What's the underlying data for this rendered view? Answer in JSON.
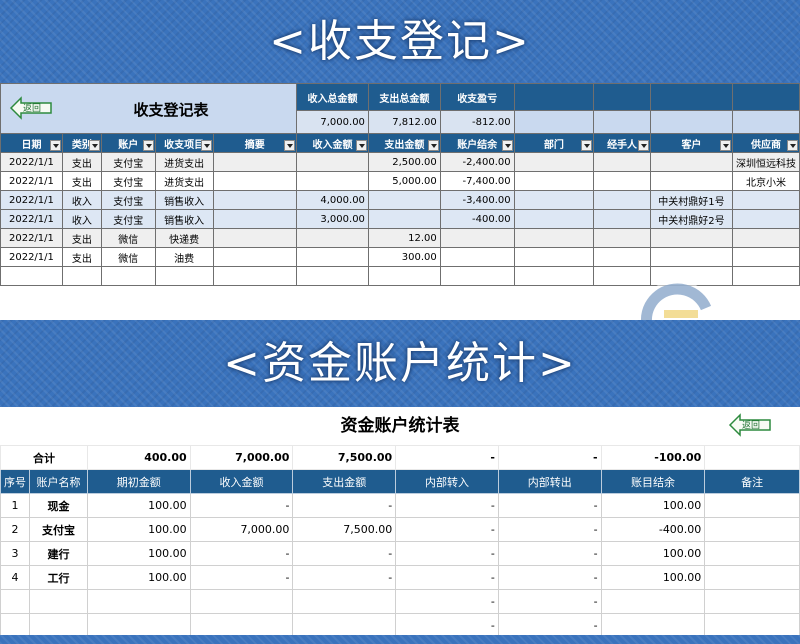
{
  "banner1": {
    "text": "<收支登记>"
  },
  "banner2": {
    "text": "<资金账户统计>"
  },
  "sheet1": {
    "back_label": "返回",
    "title": "收支登记表",
    "summary_labels": [
      "收入总金额",
      "支出总金额",
      "收支盈亏"
    ],
    "summary_values": [
      "7,000.00",
      "7,812.00",
      "-812.00"
    ],
    "headers": [
      "日期",
      "类别",
      "账户",
      "收支项目",
      "摘要",
      "收入金额",
      "支出金额",
      "账户结余",
      "部门",
      "经手人",
      "客户",
      "供应商"
    ],
    "rows": [
      [
        "2022/1/1",
        "支出",
        "支付宝",
        "进货支出",
        "",
        "",
        "2,500.00",
        "-2,400.00",
        "",
        "",
        "",
        "深圳恒远科技"
      ],
      [
        "2022/1/1",
        "支出",
        "支付宝",
        "进货支出",
        "",
        "",
        "5,000.00",
        "-7,400.00",
        "",
        "",
        "",
        "北京小米"
      ],
      [
        "2022/1/1",
        "收入",
        "支付宝",
        "销售收入",
        "",
        "4,000.00",
        "",
        "-3,400.00",
        "",
        "",
        "中关村鼎好1号",
        ""
      ],
      [
        "2022/1/1",
        "收入",
        "支付宝",
        "销售收入",
        "",
        "3,000.00",
        "",
        "-400.00",
        "",
        "",
        "中关村鼎好2号",
        ""
      ],
      [
        "2022/1/1",
        "支出",
        "微信",
        "快递费",
        "",
        "",
        "12.00",
        "",
        "",
        "",
        "",
        ""
      ],
      [
        "2022/1/1",
        "支出",
        "微信",
        "油费",
        "",
        "",
        "300.00",
        "",
        "",
        "",
        "",
        ""
      ],
      [
        "",
        "",
        "",
        "",
        "",
        "",
        "",
        "",
        "",
        "",
        "",
        ""
      ]
    ]
  },
  "sheet2": {
    "title": "资金账户统计表",
    "back_label": "返回",
    "total_label": "合计",
    "totals": [
      "400.00",
      "7,000.00",
      "7,500.00",
      "-",
      "-",
      "-100.00"
    ],
    "headers": [
      "序号",
      "账户名称",
      "期初金额",
      "收入金额",
      "支出金额",
      "内部转入",
      "内部转出",
      "账目结余",
      "备注"
    ],
    "rows": [
      [
        "1",
        "现金",
        "100.00",
        "-",
        "-",
        "-",
        "-",
        "100.00",
        ""
      ],
      [
        "2",
        "支付宝",
        "100.00",
        "7,000.00",
        "7,500.00",
        "-",
        "-",
        "-400.00",
        ""
      ],
      [
        "3",
        "建行",
        "100.00",
        "-",
        "-",
        "-",
        "-",
        "100.00",
        ""
      ],
      [
        "4",
        "工行",
        "100.00",
        "-",
        "-",
        "-",
        "-",
        "100.00",
        ""
      ],
      [
        "",
        "",
        "",
        "",
        "",
        "-",
        "-",
        "",
        ""
      ],
      [
        "",
        "",
        "",
        "",
        "",
        "-",
        "-",
        "",
        ""
      ]
    ]
  },
  "colors": {
    "header_blue": "#1f5c8f",
    "banner_blue": "#3a73bd",
    "alt_row": "#dde7f4"
  }
}
